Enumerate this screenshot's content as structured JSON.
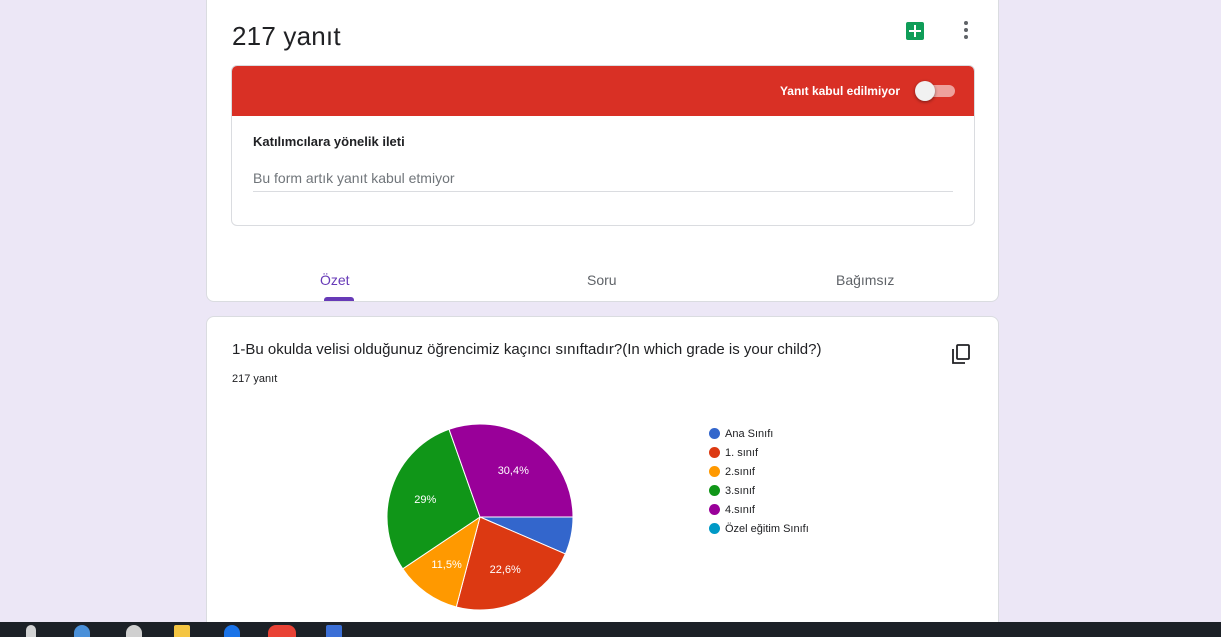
{
  "summary": {
    "response_count_title": "217 yanıt",
    "accepting_label": "Yanıt kabul edilmiyor",
    "message_heading": "Katılımcılara yönelik ileti",
    "message_text": "Bu form artık yanıt kabul etmiyor",
    "tabs": [
      {
        "label": "Özet"
      },
      {
        "label": "Soru"
      },
      {
        "label": "Bağımsız"
      }
    ]
  },
  "question": {
    "title": "1-Bu okulda velisi olduğunuz öğrencimiz kaçıncı sınıftadır?(In which grade is your child?)",
    "response_count": "217 yanıt"
  },
  "colors": {
    "header_red": "#d93025",
    "accent_purple": "#673ab7",
    "sheets_green": "#0f9d58"
  },
  "icons": [
    "sheets-icon",
    "more-vert-icon",
    "copy-icon"
  ],
  "chart_data": {
    "type": "pie",
    "categories": [
      "Ana Sınıfı",
      "1. sınıf",
      "2.sınıf",
      "3.sınıf",
      "4.sınıf",
      "Özel eğitim Sınıfı"
    ],
    "values": [
      6.5,
      22.6,
      11.5,
      29,
      30.4,
      0
    ],
    "colors": [
      "#3366cc",
      "#dc3912",
      "#ff9900",
      "#109618",
      "#990099",
      "#0099c6"
    ],
    "slice_labels": [
      "",
      "22,6%",
      "11,5%",
      "29%",
      "30,4%",
      ""
    ],
    "legend_position": "right"
  },
  "taskbar": {
    "icons": [
      "start-icon",
      "browser-icon",
      "store-icon",
      "folder-icon",
      "edge-icon",
      "chrome-icon",
      "app-icon"
    ]
  }
}
